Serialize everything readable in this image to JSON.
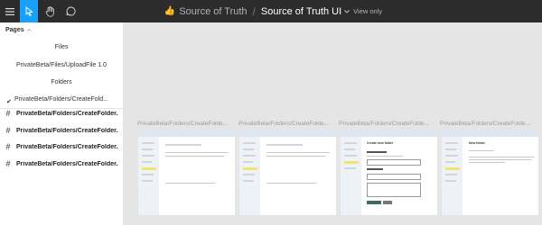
{
  "toolbar": {
    "icons": [
      "hamburger-menu-icon",
      "move-cursor-icon",
      "hand-icon",
      "comment-icon"
    ]
  },
  "title": {
    "emoji": "👍",
    "team": "Source of Truth",
    "separator": "/",
    "file_name": "Source of Truth UI",
    "mode": "View only"
  },
  "sidebar": {
    "pages_label": "Pages",
    "pages": [
      "Files",
      "PrivateBeta/Files/UploadFile 1.0",
      "Folders",
      "PrivateBeta/Folders/CreateFold..."
    ],
    "selected_mark": "✔",
    "frames": [
      "PrivateBeta/Folders/CreateFolder...",
      "PrivateBeta/Folders/CreateFolder...",
      "PrivateBeta/Folders/CreateFolder...",
      "PrivateBeta/Folders/CreateFolder..."
    ]
  },
  "canvas": {
    "frame_titles": [
      "PrivateBeta/Folders/CreateFolde...",
      "PrivateBeta/Folders/CreateFolde...",
      "PrivateBeta/Folders/CreateFolde...",
      "PrivateBeta/Folders/CreateFolde..."
    ],
    "frame3_heading": "Create new folder",
    "frame4_heading": "New folder"
  },
  "colors": {
    "topbar": "#2c2c2c",
    "accent": "#18a0fb",
    "canvas": "#e5e5e5"
  }
}
